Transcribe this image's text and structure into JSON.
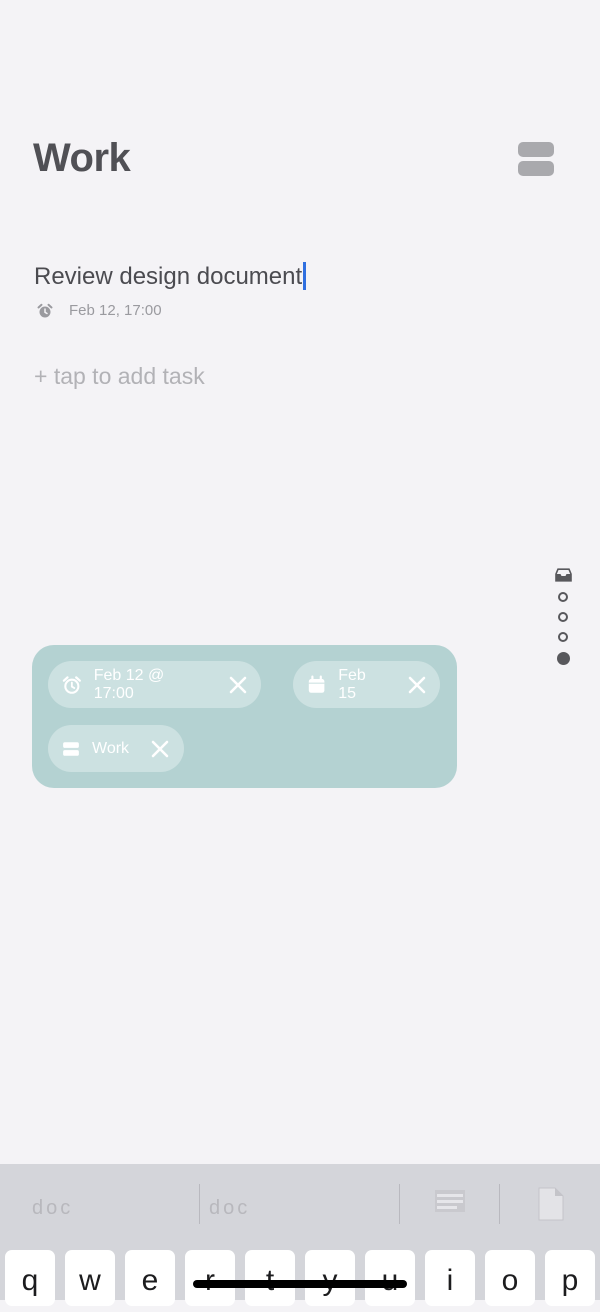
{
  "header": {
    "title": "Work"
  },
  "task": {
    "title": "Review design document",
    "reminder": "Feb 12, 17:00"
  },
  "add_task": {
    "label": "+ tap to add task"
  },
  "chips": {
    "reminder": "Feb 12 @ 17:00",
    "due": "Feb 15",
    "list": "Work"
  },
  "keyboard": {
    "suggestions": [
      "doc",
      "doc"
    ],
    "keys": [
      "q",
      "w",
      "e",
      "r",
      "t",
      "y",
      "u",
      "i",
      "o",
      "p"
    ]
  },
  "colors": {
    "background": "#f4f3f6",
    "panel": "#b4d2d2",
    "caret": "#2f6fe0",
    "keyboard": "#d4d5da"
  },
  "icons": {
    "list_button": "stacked-bars-icon",
    "reminder": "alarm-clock-icon",
    "due": "calendar-icon",
    "list": "list-icon",
    "remove": "close-icon",
    "pager_first": "inbox-icon"
  }
}
